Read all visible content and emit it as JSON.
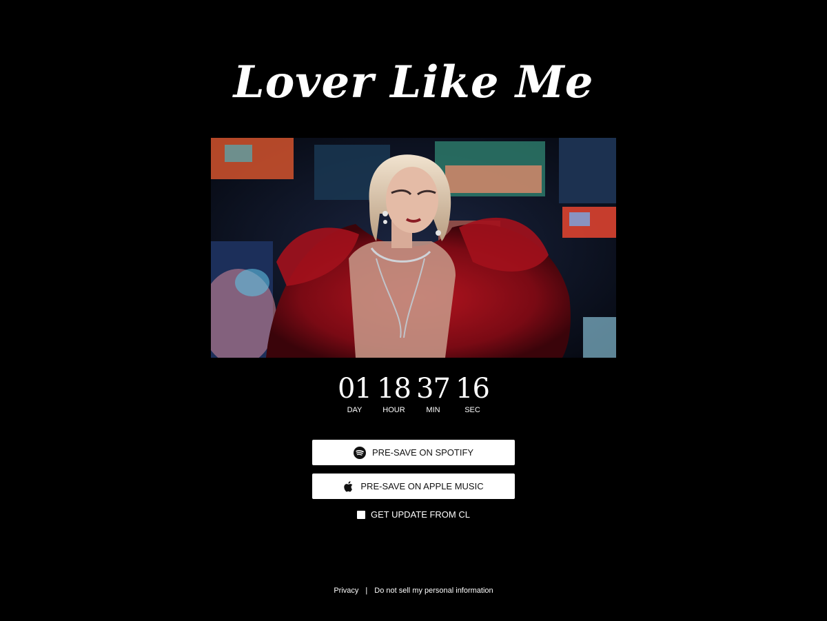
{
  "header": {
    "title": "Lover Like Me"
  },
  "hero": {
    "alt": "Artist in red feathered gown"
  },
  "countdown": [
    {
      "value": "01",
      "label": "DAY"
    },
    {
      "value": "18",
      "label": "HOUR"
    },
    {
      "value": "37",
      "label": "MIN"
    },
    {
      "value": "16",
      "label": "SEC"
    }
  ],
  "actions": {
    "spotify": {
      "label": "PRE-SAVE ON SPOTIFY",
      "icon": "spotify-icon"
    },
    "apple": {
      "label": "PRE-SAVE ON APPLE MUSIC",
      "icon": "apple-icon"
    }
  },
  "optin": {
    "label": "GET UPDATE FROM CL",
    "checked": false
  },
  "footer": {
    "privacy": "Privacy",
    "separator": "|",
    "do_not_sell": "Do not sell my personal information"
  },
  "colors": {
    "background": "#000000",
    "button_bg": "#ffffff",
    "button_text": "#111111",
    "text": "#ffffff"
  }
}
